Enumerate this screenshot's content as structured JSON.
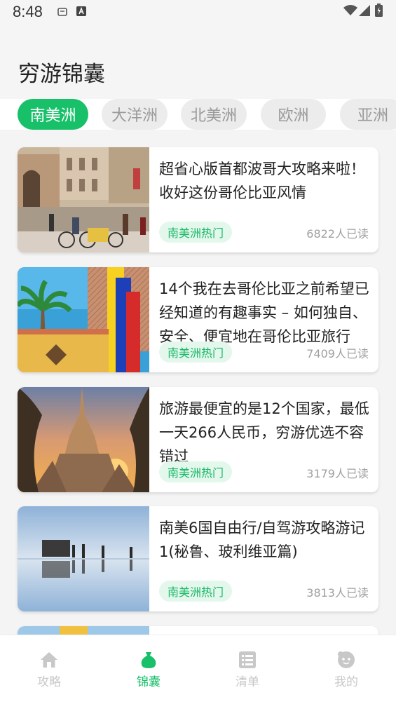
{
  "status_bar": {
    "time": "8:48"
  },
  "header": {
    "title": "穷游锦囊"
  },
  "tabs": [
    {
      "label": "南美洲",
      "active": true
    },
    {
      "label": "大洋洲",
      "active": false
    },
    {
      "label": "北美洲",
      "active": false
    },
    {
      "label": "欧洲",
      "active": false
    },
    {
      "label": "亚洲",
      "active": false
    }
  ],
  "articles": [
    {
      "title": "超省心版首都波哥大攻略来啦！收好这份哥伦比亚风情",
      "tag": "南美洲热门",
      "reads": "6822人已读",
      "image": "city-street-cyclists"
    },
    {
      "title": "14个我在去哥伦比亚之前希望已经知道的有趣事实 – 如何独自、安全、便宜地在哥伦比亚旅行",
      "tag": "南美洲热门",
      "reads": "7409人已读",
      "image": "colombia-flag-palm"
    },
    {
      "title": "旅游最便宜的是12个国家，最低一天266人民币，穷游优选不容错过",
      "tag": "南美洲热门",
      "reads": "3179人已读",
      "image": "thai-temple-sunset"
    },
    {
      "title": "南美6国自由行/自驾游攻略游记1(秘鲁、玻利维亚篇)",
      "tag": "南美洲热门",
      "reads": "3813人已读",
      "image": "salt-flat-reflection"
    }
  ],
  "bottom_nav": [
    {
      "label": "攻略",
      "icon": "home-icon",
      "active": false
    },
    {
      "label": "锦囊",
      "icon": "bag-icon",
      "active": true
    },
    {
      "label": "清单",
      "icon": "list-icon",
      "active": false
    },
    {
      "label": "我的",
      "icon": "face-icon",
      "active": false
    }
  ],
  "colors": {
    "accent": "#18c069",
    "tag_bg": "#e3f7ec",
    "tag_text": "#18b865",
    "inactive": "#c8c8c8"
  }
}
